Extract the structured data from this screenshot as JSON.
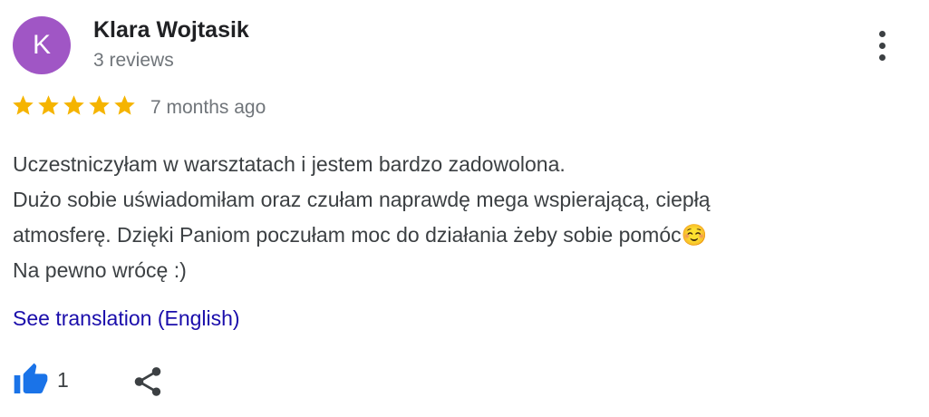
{
  "author": {
    "initial": "K",
    "name": "Klara Wojtasik",
    "reviews": "3 reviews",
    "avatar_color": "#a056c5"
  },
  "menu": {
    "icon": "more-vertical-icon"
  },
  "rating": {
    "stars": 5,
    "max": 5,
    "star_color": "#f5b400",
    "date": "7 months ago"
  },
  "review": {
    "lines": [
      "Uczestniczyłam w warsztatach i jestem bardzo zadowolona.",
      "Dużo sobie uświadomiłam oraz czułam naprawdę mega wspierającą, ciepłą",
      "atmosferę. Dzięki Paniom poczułam moc do działania żeby sobie pomóc☺️",
      "Na pewno wrócę :)"
    ]
  },
  "translation_link": "See translation (English)",
  "actions": {
    "like_icon": "thumbs-up-icon",
    "like_color": "#1a73e8",
    "like_count": "1",
    "share_icon": "share-icon"
  }
}
